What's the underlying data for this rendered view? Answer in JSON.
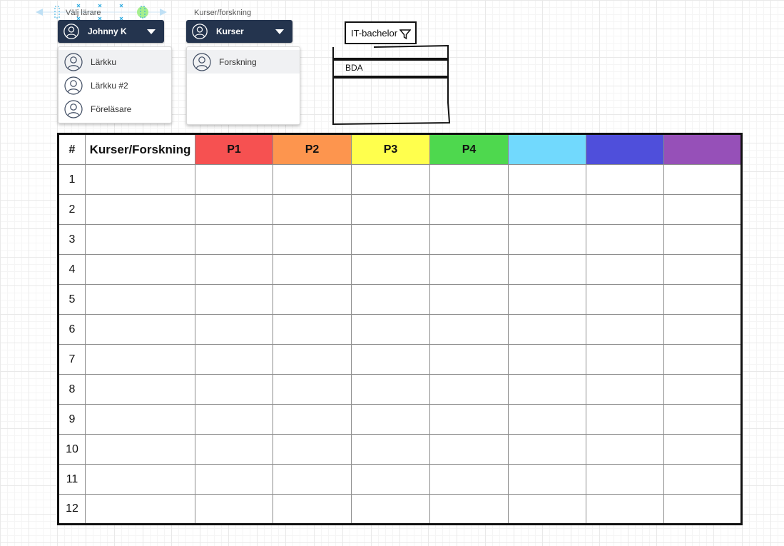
{
  "teacher_select": {
    "label": "Välj lärare",
    "selected": "Johnny K",
    "options": [
      "Lärkku",
      "Lärkku #2",
      "Föreläsare"
    ]
  },
  "course_select": {
    "label": "Kurser/forskning",
    "selected": "Kurser",
    "options": [
      "Forskning"
    ]
  },
  "program_filter": {
    "value": "IT-bachelor",
    "list_items": [
      "BDA"
    ]
  },
  "schedule": {
    "headers": [
      "#",
      "Kurser/Forskning",
      "P1",
      "P2",
      "P3",
      "P4",
      "",
      "",
      ""
    ],
    "header_colors": [
      "#ffffff",
      "#ffffff",
      "#f65151",
      "#fd954e",
      "#ffff4d",
      "#4ed84e",
      "#71d9fd",
      "#4f4fdb",
      "#9650b8"
    ],
    "rows": [
      "1",
      "2",
      "3",
      "4",
      "5",
      "6",
      "7",
      "8",
      "9",
      "10",
      "11",
      "12"
    ]
  },
  "colors": {
    "dropdown_bg": "#24344e",
    "selection_accent": "#29a9e0"
  }
}
